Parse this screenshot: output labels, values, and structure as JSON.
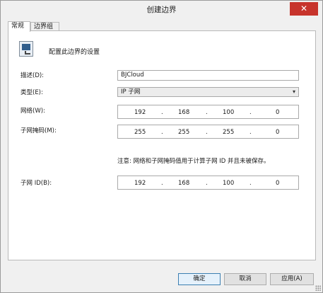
{
  "window": {
    "title": "创建边界",
    "close_glyph": "✕"
  },
  "tabs": [
    {
      "label": "常规",
      "active": true
    },
    {
      "label": "边界组",
      "active": false
    }
  ],
  "header": {
    "text": "配置此边界的设置",
    "icon": "network-computer-icon"
  },
  "fields": {
    "description": {
      "label": "描述(D):",
      "value": "BJCloud"
    },
    "type": {
      "label": "类型(E):",
      "value": "IP 子网",
      "chevron": "▾"
    },
    "network": {
      "label": "网络(W):",
      "octets": [
        "192",
        "168",
        "100",
        "0"
      ]
    },
    "subnet_mask": {
      "label": "子网掩码(M):",
      "octets": [
        "255",
        "255",
        "255",
        "0"
      ]
    },
    "subnet_id": {
      "label": "子网 ID(B):",
      "octets": [
        "192",
        "168",
        "100",
        "0"
      ]
    }
  },
  "note": "注意: 网络和子网掩码值用于计算子网 ID 并且未被保存。",
  "ip_separator": ".",
  "buttons": {
    "ok": "确定",
    "cancel": "取消",
    "apply": "应用(A)"
  },
  "colors": {
    "close_red": "#c7342c",
    "default_button_border": "#3c7fb1"
  }
}
